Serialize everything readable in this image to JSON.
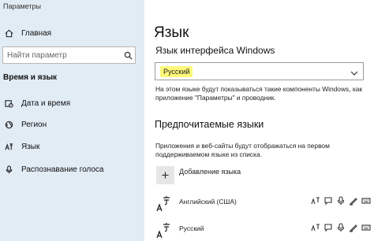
{
  "window": {
    "title": "Параметры"
  },
  "sidebar": {
    "home_label": "Главная",
    "search_placeholder": "Найти параметр",
    "section_title": "Время и язык",
    "items": [
      {
        "label": "Дата и время",
        "icon": "calendar-clock-icon"
      },
      {
        "label": "Регион",
        "icon": "globe-icon"
      },
      {
        "label": "Язык",
        "icon": "language-icon"
      },
      {
        "label": "Распознавание голоса",
        "icon": "microphone-icon"
      }
    ]
  },
  "main": {
    "title": "Язык",
    "display_language": {
      "heading": "Язык интерфейса Windows",
      "selected": "Русский",
      "description_line1": "На этом языке будут показываться такие компоненты Windows, как",
      "description_line2": "приложение \"Параметры\" и проводник."
    },
    "preferred": {
      "heading": "Предпочитаемые языки",
      "description_line1": "Приложения и веб-сайты будут отображаться на первом",
      "description_line2": "поддерживаемом языке из списка.",
      "add_label": "Добавление языка",
      "add_symbol": "+",
      "languages": [
        {
          "name": "Английский (США)"
        },
        {
          "name": "Русский"
        }
      ]
    }
  },
  "colors": {
    "sidebar_bg": "#e1ecf5",
    "selection_highlight": "#fff97a"
  }
}
